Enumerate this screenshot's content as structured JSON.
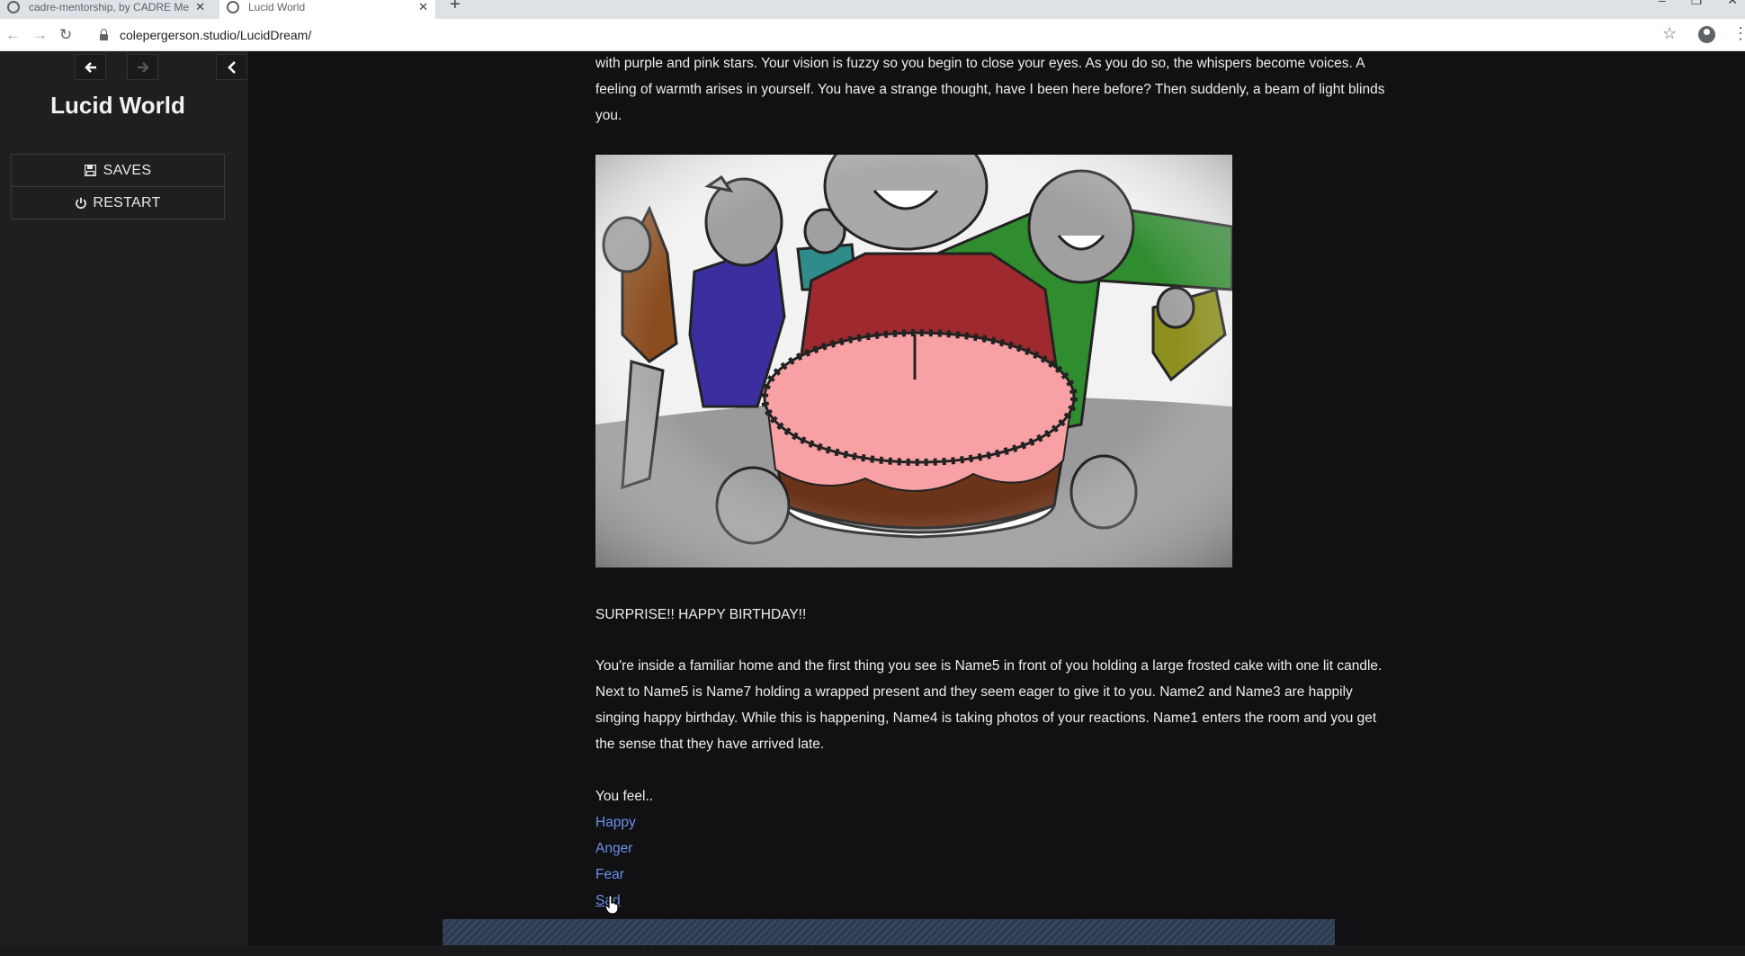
{
  "browser": {
    "tabs": [
      {
        "title": "cadre-mentorship, by CADRE Me",
        "active": false
      },
      {
        "title": "Lucid World",
        "active": true
      }
    ],
    "new_tab_label": "+",
    "url": "colepergerson.studio/LucidDream/"
  },
  "sidebar": {
    "back_icon": "arrow-left-icon",
    "forward_icon": "arrow-right-icon",
    "collapse_icon": "chevron-left-icon",
    "story_title": "Lucid World",
    "menu": [
      {
        "label": "SAVES",
        "icon": "floppy-disk-icon"
      },
      {
        "label": "RESTART",
        "icon": "power-icon"
      }
    ]
  },
  "passage": {
    "intro": "with purple and pink stars. Your vision is fuzzy so you begin to close your eyes. As you do so, the whispers become voices. A feeling of warmth arises in yourself. You have a strange thought, have I been here before? Then suddenly, a beam of light blinds you.",
    "surprise": "SURPRISE!! HAPPY BIRTHDAY!!",
    "description": "You're inside a familiar home and the first thing you see is Name5 in front of you holding a large frosted cake with one lit candle. Next to Name5 is Name7 holding a wrapped present and they seem eager to give it to you. Name2 and Name3 are happily singing happy birthday. While this is happening, Name4 is taking photos of your reactions. Name1 enters the room and you get the sense that they have arrived late.",
    "prompt": "You feel..",
    "choices": [
      "Happy",
      "Anger",
      "Fear",
      "Sad"
    ]
  },
  "colors": {
    "background": "#111114",
    "sidebar": "#1f1f22",
    "link": "#6b8fe6",
    "cake_frosting": "#f7a1a5",
    "cake_base": "#6b3318",
    "shirt_red": "#9e2a2f",
    "shirt_green": "#2f8c2f",
    "shirt_purple": "#3b2fa0",
    "shirt_brown": "#8a4d1f",
    "shirt_olive": "#8d8f1e",
    "shirt_teal": "#2f8c8a"
  }
}
